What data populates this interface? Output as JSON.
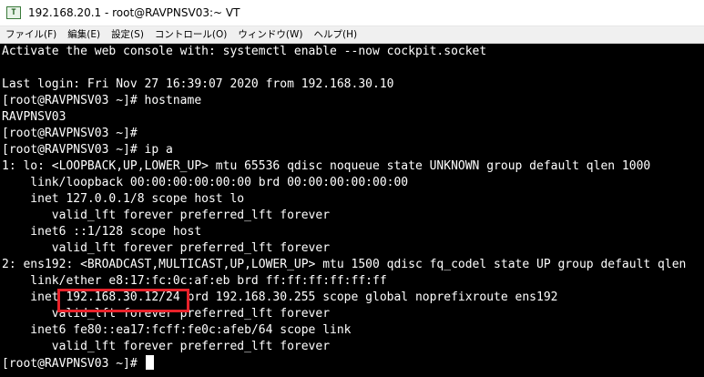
{
  "window": {
    "title": "192.168.20.1 - root@RAVPNSV03:~ VT",
    "icon_label": "T",
    "accent_color": "#e8222a"
  },
  "menu": [
    "ファイル(F)",
    "編集(E)",
    "設定(S)",
    "コントロール(O)",
    "ウィンドウ(W)",
    "ヘルプ(H)"
  ],
  "terminal": {
    "lines": [
      "Activate the web console with: systemctl enable --now cockpit.socket",
      "",
      "Last login: Fri Nov 27 16:39:07 2020 from 192.168.30.10",
      "[root@RAVPNSV03 ~]# hostname",
      "RAVPNSV03",
      "[root@RAVPNSV03 ~]#",
      "[root@RAVPNSV03 ~]# ip a",
      "1: lo: <LOOPBACK,UP,LOWER_UP> mtu 65536 qdisc noqueue state UNKNOWN group default qlen 1000",
      "    link/loopback 00:00:00:00:00:00 brd 00:00:00:00:00:00",
      "    inet 127.0.0.1/8 scope host lo",
      "       valid_lft forever preferred_lft forever",
      "    inet6 ::1/128 scope host",
      "       valid_lft forever preferred_lft forever",
      "2: ens192: <BROADCAST,MULTICAST,UP,LOWER_UP> mtu 1500 qdisc fq_codel state UP group default qlen",
      "    link/ether e8:17:fc:0c:af:eb brd ff:ff:ff:ff:ff:ff",
      "    inet 192.168.30.12/24 brd 192.168.30.255 scope global noprefixroute ens192",
      "       valid_lft forever preferred_lft forever",
      "    inet6 fe80::ea17:fcff:fe0c:afeb/64 scope link",
      "       valid_lft forever preferred_lft forever"
    ],
    "prompt": "[root@RAVPNSV03 ~]#",
    "highlighted_text": "192.168.30.12/24"
  }
}
